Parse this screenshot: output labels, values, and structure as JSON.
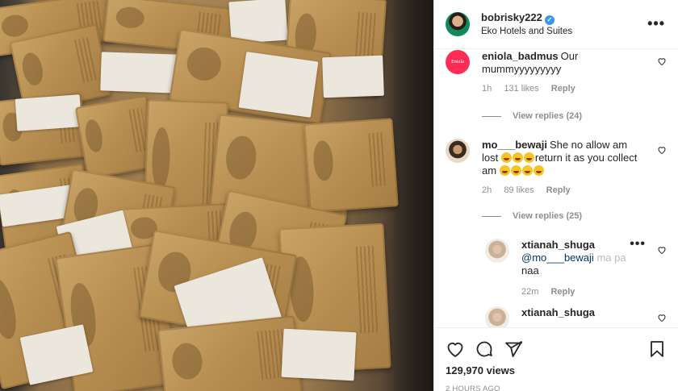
{
  "post": {
    "owner": "bobrisky222",
    "location": "Eko Hotels and Suites",
    "more_label": "•••"
  },
  "comments": [
    {
      "user": "eniola_badmus",
      "text": "Our mummyyyyyyyyy",
      "time": "1h",
      "likes": "131 likes",
      "reply": "Reply",
      "view_replies": "View replies (24)"
    },
    {
      "user": "mo___bewaji",
      "text": "She no allow am lost",
      "text2": "return it as you collect am",
      "time": "2h",
      "likes": "89 likes",
      "reply": "Reply",
      "view_replies": "View replies (25)"
    }
  ],
  "replies": [
    {
      "user": "xtianah_shuga",
      "mention": "@mo___bewaji",
      "text": "ma pa",
      "text2": "naa",
      "time": "22m",
      "reply": "Reply"
    },
    {
      "user": "xtianah_shuga"
    }
  ],
  "stats": {
    "views": "129,970 views",
    "posted": "2 HOURS AGO"
  },
  "icons": [
    "heart-icon",
    "comment-icon",
    "share-icon",
    "bookmark-icon",
    "more-icon",
    "verified-icon"
  ],
  "colors": {
    "verified": "#3897f0",
    "muted": "#8e8e8e",
    "mention": "#00376b"
  }
}
